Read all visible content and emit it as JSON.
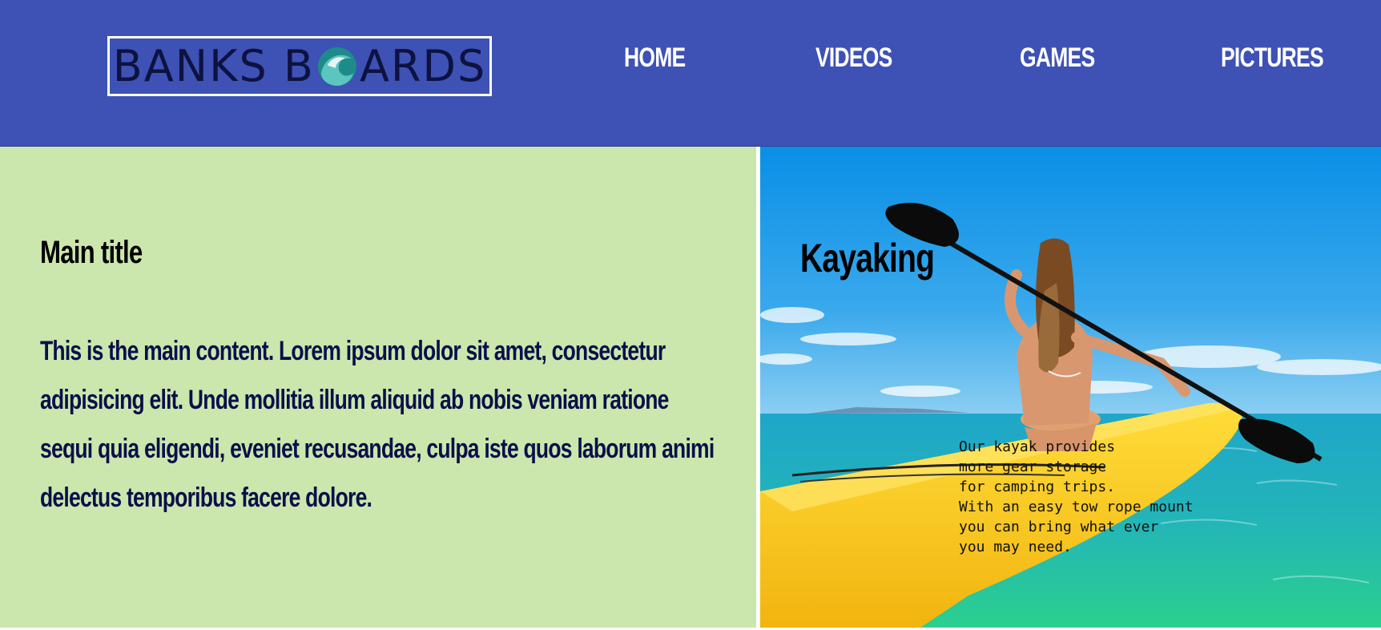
{
  "header": {
    "logo": {
      "text_left": "BANKS B",
      "text_right": "ARDS",
      "icon": "wave-icon"
    },
    "nav": [
      {
        "label": "HOME"
      },
      {
        "label": "VIDEOS"
      },
      {
        "label": "GAMES"
      },
      {
        "label": "PICTURES"
      }
    ]
  },
  "main": {
    "title": "Main title",
    "content": "This is the main content. Lorem ipsum dolor sit amet, consectetur adipisicing elit. Unde mollitia illum aliquid ab nobis veniam ratione sequi quia eligendi, eveniet recusandae, culpa iste quos laborum animi delectus temporibus facere dolore."
  },
  "feature": {
    "title": "Kayaking",
    "description": "Our kayak provides\nmore gear storage\nfor camping trips.\nWith an easy tow rope mount\nyou can bring what ever\nyou may need."
  },
  "colors": {
    "header_bg": "#3e51b5",
    "left_panel_bg": "#cbe7ad",
    "main_text": "#0b0f4a",
    "kayak_yellow": "#f7c51a"
  }
}
